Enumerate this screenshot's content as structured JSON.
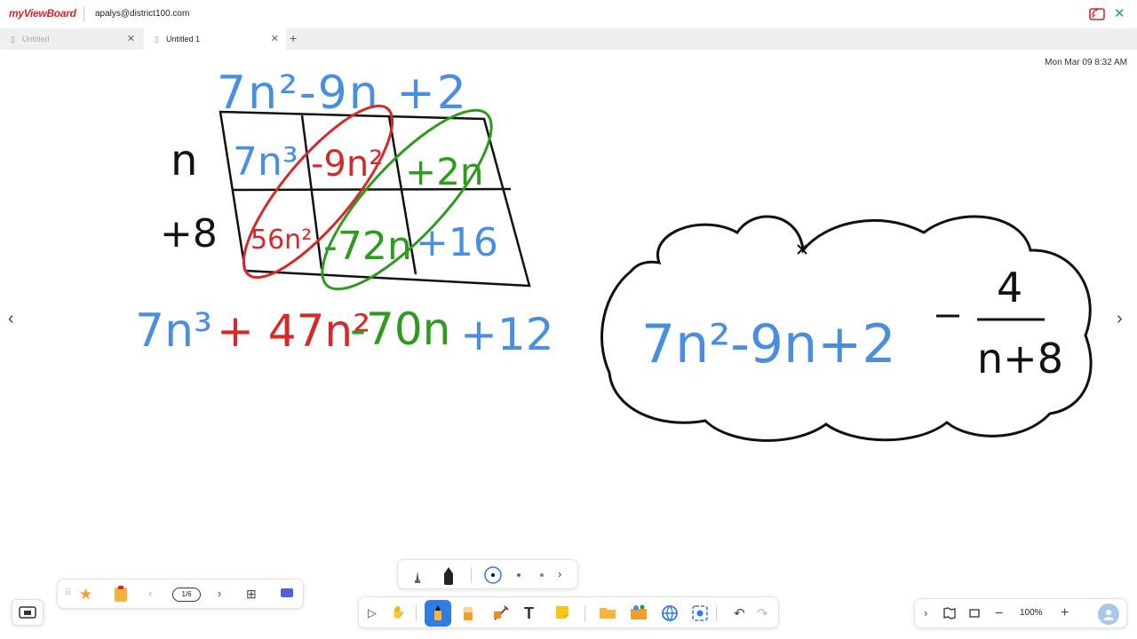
{
  "app": {
    "logo_text": "myViewBoard",
    "user_email": "apalys@district100.com",
    "datetime": "Mon Mar 09 8:32 AM"
  },
  "tabs": [
    {
      "label": "Untitled",
      "active": false
    },
    {
      "label": "Untitled 1",
      "active": true
    }
  ],
  "page_nav": {
    "indicator": "1/6"
  },
  "zoom": {
    "level": "100%"
  },
  "board": {
    "top_expression": "7n²-9n +2",
    "row_labels": [
      "n",
      "+8"
    ],
    "grid_cells": [
      "7n³",
      "-9n²",
      "+2n",
      "56n²",
      "-72n",
      "+16"
    ],
    "result_expression": [
      "7n³",
      "+ 47n²",
      "-70n",
      "+12"
    ],
    "cloud_expression": [
      "7n²-9n+2",
      "4",
      "n+8"
    ],
    "colors": {
      "blue": "#4a8ee0",
      "red": "#d42a2a",
      "green": "#2e9a1e",
      "black": "#111111",
      "accent": "#2f7de1"
    }
  }
}
